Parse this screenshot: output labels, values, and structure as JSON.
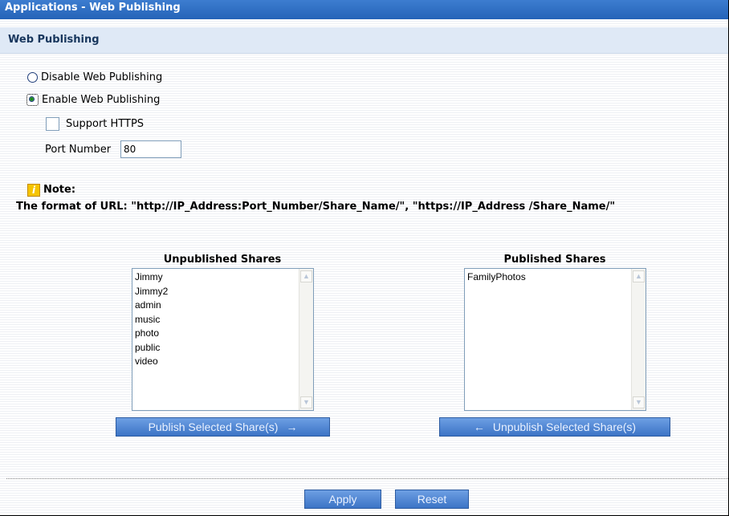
{
  "header": {
    "title": "Applications - Web Publishing"
  },
  "section": {
    "title": "Web Publishing"
  },
  "options": {
    "disable_label": "Disable Web Publishing",
    "enable_label": "Enable Web Publishing",
    "selected": "enable",
    "https_label": "Support HTTPS",
    "https_checked": false,
    "port_label": "Port Number",
    "port_value": "80"
  },
  "note": {
    "label": "Note:",
    "text": "The format of URL: \"http://IP_Address:Port_Number/Share_Name/\", \"https://IP_Address /Share_Name/\""
  },
  "unpublished": {
    "title": "Unpublished Shares",
    "items": [
      "Jimmy",
      "Jimmy2",
      "admin",
      "music",
      "photo",
      "public",
      "video"
    ],
    "button_label": "Publish Selected Share(s)",
    "button_arrow": "→"
  },
  "published": {
    "title": "Published Shares",
    "items": [
      "FamilyPhotos"
    ],
    "button_label": "Unpublish Selected Share(s)",
    "button_arrow": "←"
  },
  "footer": {
    "apply_label": "Apply",
    "reset_label": "Reset"
  },
  "icons": {
    "note": "info-note-icon",
    "scroll_up": "scroll-up-arrow-icon",
    "scroll_down": "scroll-down-arrow-icon"
  },
  "colors": {
    "title_bar": "#2d6cc0",
    "button": "#4a82d0",
    "section_bg": "#dfe9f6"
  }
}
